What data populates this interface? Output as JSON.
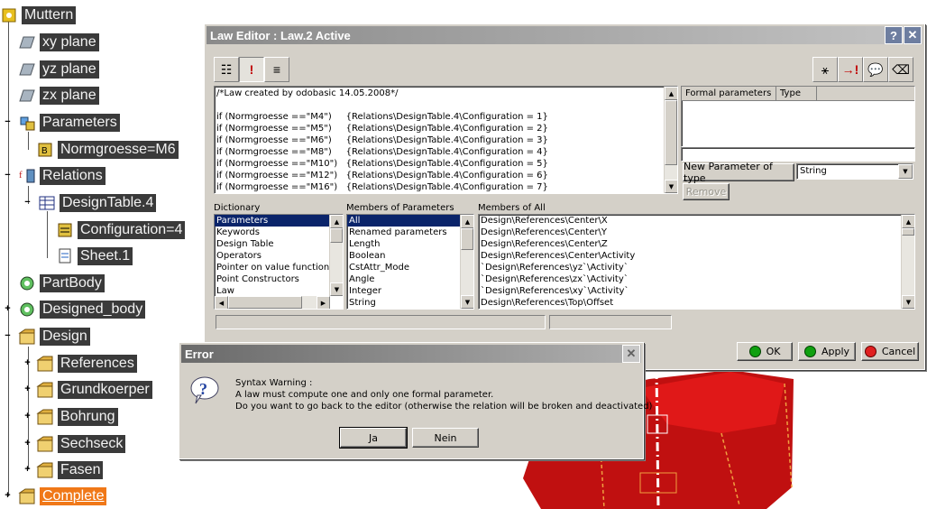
{
  "tree": {
    "items": [
      {
        "label": "Muttern"
      },
      {
        "label": "xy plane"
      },
      {
        "label": "yz plane"
      },
      {
        "label": "zx plane"
      },
      {
        "label": "Parameters"
      },
      {
        "label": "Normgroesse=M6"
      },
      {
        "label": "Relations"
      },
      {
        "label": "DesignTable.4"
      },
      {
        "label": "Configuration=4"
      },
      {
        "label": "Sheet.1"
      },
      {
        "label": "PartBody"
      },
      {
        "label": "Designed_body"
      },
      {
        "label": "Design"
      },
      {
        "label": "References"
      },
      {
        "label": "Grundkoerper"
      },
      {
        "label": "Bohrung"
      },
      {
        "label": "Sechseck"
      },
      {
        "label": "Fasen"
      },
      {
        "label": "Complete"
      }
    ]
  },
  "law_editor": {
    "title": "Law Editor : Law.2 Active",
    "help_label": "?",
    "close_label": "✕",
    "code_lines": [
      "/*Law created by odobasic 14.05.2008*/",
      "",
      "if (Normgroesse ==\"M4\")     {Relations\\DesignTable.4\\Configuration = 1}",
      "if (Normgroesse ==\"M5\")     {Relations\\DesignTable.4\\Configuration = 2}",
      "if (Normgroesse ==\"M6\")     {Relations\\DesignTable.4\\Configuration = 3}",
      "if (Normgroesse ==\"M8\")     {Relations\\DesignTable.4\\Configuration = 4}",
      "if (Normgroesse ==\"M10\")   {Relations\\DesignTable.4\\Configuration = 5}",
      "if (Normgroesse ==\"M12\")   {Relations\\DesignTable.4\\Configuration = 6}",
      "if (Normgroesse ==\"M16\")   {Relations\\DesignTable.4\\Configuration = 7}"
    ],
    "formal_params_header": "Formal parameters",
    "type_header": "Type",
    "new_param_button": "New Parameter of type",
    "param_type_value": "String",
    "remove_button": "Remove",
    "dictionary_label": "Dictionary",
    "dictionary_items": [
      "Parameters",
      "Keywords",
      "Design Table",
      "Operators",
      "Pointer on value functions",
      "Point Constructors",
      "Law"
    ],
    "members_params_label": "Members of Parameters",
    "members_params_items": [
      "All",
      "Renamed parameters",
      "Length",
      "Boolean",
      "CstAttr_Mode",
      "Angle",
      "Integer",
      "String"
    ],
    "members_all_label": "Members of All",
    "members_all_items": [
      "Design\\References\\Center\\X",
      "Design\\References\\Center\\Y",
      "Design\\References\\Center\\Z",
      "Design\\References\\Center\\Activity",
      "`Design\\References\\yz`\\Activity`",
      "`Design\\References\\zx`\\Activity`",
      "`Design\\References\\xy`\\Activity`",
      "Design\\References\\Top\\Offset"
    ],
    "ok_label": "OK",
    "apply_label": "Apply",
    "cancel_label": "Cancel"
  },
  "error_dialog": {
    "title": "Error",
    "close_label": "✕",
    "line1": "Syntax Warning :",
    "line2": " A law must compute one and only one formal parameter.",
    "line3": "Do you want to go back to the editor (otherwise the relation will be broken and deactivated)",
    "yes_label": "Ja",
    "no_label": "Nein"
  },
  "colors": {
    "tree_label_bg": "#3a3a3a",
    "highlight": "#f07818",
    "selection": "#0a246a",
    "dialog_bg": "#d4d0c8",
    "model_red": "#c01010",
    "ok_green": "#10a010",
    "cancel_red": "#e02020"
  }
}
